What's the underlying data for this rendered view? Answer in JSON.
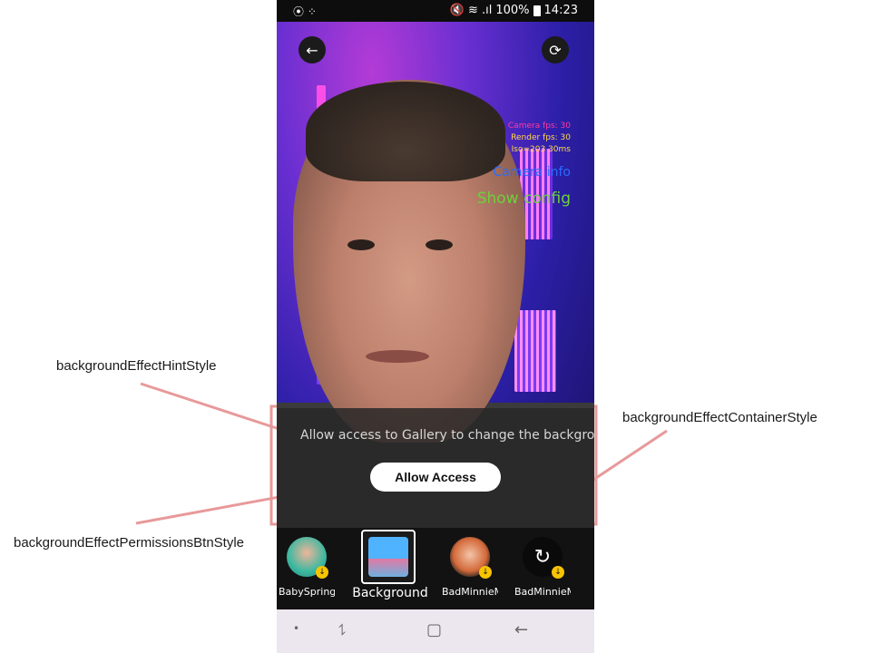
{
  "annotations": {
    "hint_style": "backgroundEffectHintStyle",
    "container_style": "backgroundEffectContainerStyle",
    "permissions_btn_style": "backgroundEffectPermissionsBtnStyle"
  },
  "statusbar": {
    "left_icons": "⦿ ⁘",
    "signal": "🔇 ≋ .ıl",
    "battery_pct": "100%",
    "time": "14:23"
  },
  "camera": {
    "camera_fps": "Camera fps: 30",
    "render_fps": "Render fps: 30",
    "iso": "Iso=203  30ms",
    "camera_info": "Camera info",
    "show_config": "Show config"
  },
  "background_effect": {
    "hint": "Allow access to Gallery to change the background",
    "allow_button": "Allow Access"
  },
  "effects": [
    {
      "name": "BabySpring..."
    },
    {
      "name": "Background"
    },
    {
      "name": "BadMinnieM..."
    },
    {
      "name": "BadMinnieM..."
    }
  ],
  "colors": {
    "accent_pink": "#e8999a",
    "camera_fps": "#ff3aa0",
    "render_fps": "#ffd84a",
    "camera_info": "#2a6cff",
    "show_config": "#6bd23a"
  }
}
